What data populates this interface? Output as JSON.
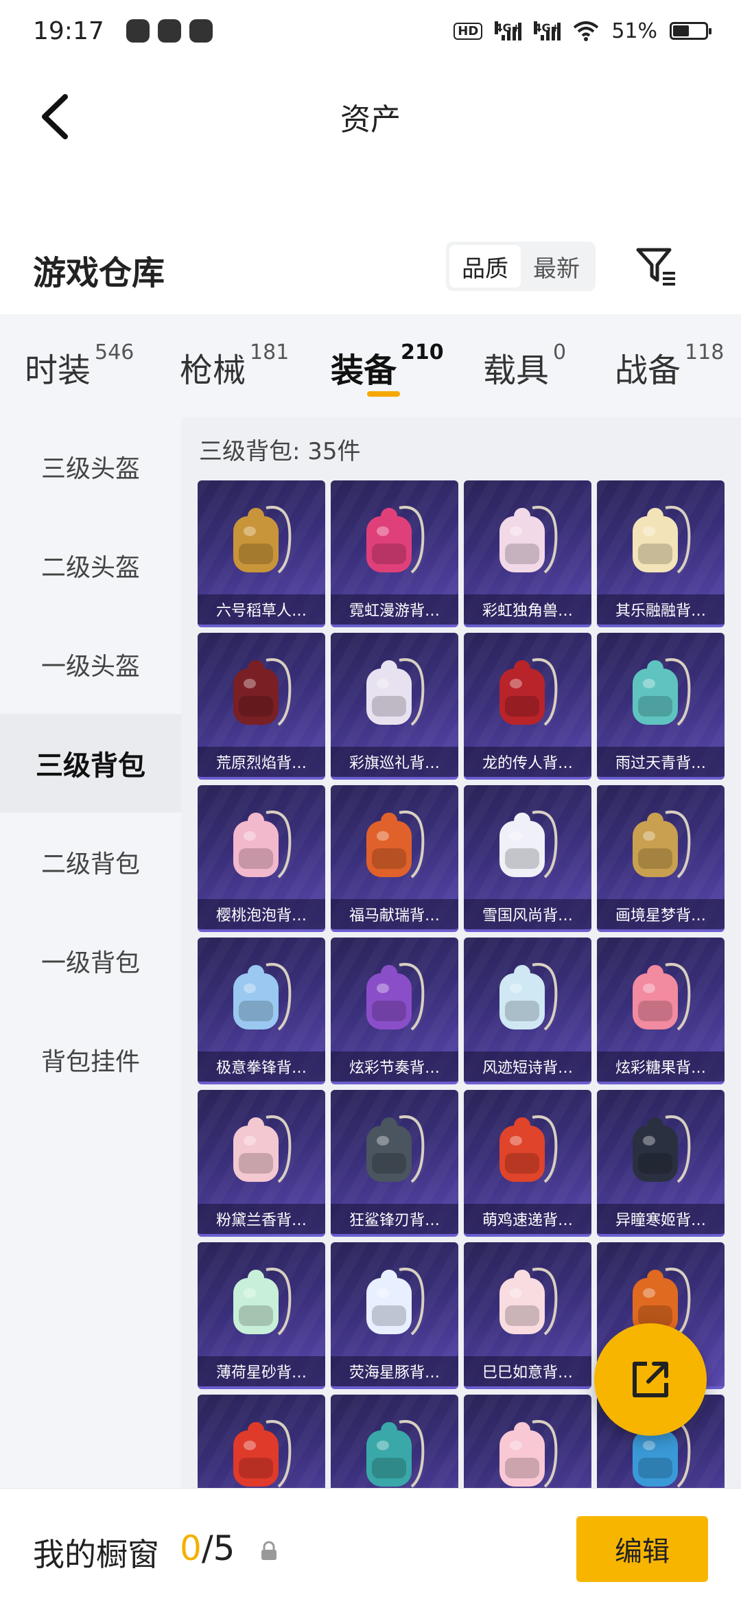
{
  "status_bar": {
    "time": "19:17",
    "battery": "51%",
    "battery_level": 0.51,
    "network_1": "4G+",
    "network_2": "4G+",
    "hd_label": "HD"
  },
  "header": {
    "title": "资产"
  },
  "warehouse": {
    "title": "游戏仓库",
    "sort_options": [
      "品质",
      "最新"
    ],
    "active_sort": "品质"
  },
  "tabs": [
    {
      "label": "时装",
      "count": "546"
    },
    {
      "label": "枪械",
      "count": "181"
    },
    {
      "label": "装备",
      "count": "210"
    },
    {
      "label": "载具",
      "count": "0"
    },
    {
      "label": "战备",
      "count": "118"
    }
  ],
  "active_tab": "装备",
  "sidebar": {
    "items": [
      "三级头盔",
      "二级头盔",
      "一级头盔",
      "三级背包",
      "二级背包",
      "一级背包",
      "背包挂件"
    ],
    "active": "三级背包"
  },
  "section": {
    "title": "三级背包: 35件"
  },
  "items": [
    "六号稻草人…",
    "霓虹漫游背…",
    "彩虹独角兽…",
    "其乐融融背…",
    "荒原烈焰背…",
    "彩旗巡礼背…",
    "龙的传人背…",
    "雨过天青背…",
    "樱桃泡泡背…",
    "福马献瑞背…",
    "雪国风尚背…",
    "画境星梦背…",
    "极意拳锋背…",
    "炫彩节奏背…",
    "风迹短诗背…",
    "炫彩糖果背…",
    "粉黛兰香背…",
    "狂鲨锋刃背…",
    "萌鸡速递背…",
    "异瞳寒姬背…",
    "薄荷星砂背…",
    "荧海星豚背…",
    "巳巳如意背…",
    "",
    "",
    "",
    "",
    ""
  ],
  "item_colors": [
    "#c9953a",
    "#e0407a",
    "#f2d9e8",
    "#f3e3b8",
    "#7a1f24",
    "#e8e2f0",
    "#b8242a",
    "#5fc4c0",
    "#f2b8cc",
    "#e0622a",
    "#f0f0f8",
    "#c8a050",
    "#9ac8f0",
    "#8a4fc8",
    "#cfe8f4",
    "#f28aa0",
    "#f4c8d0",
    "#4a5560",
    "#e0442a",
    "#2a3040",
    "#c8f0d8",
    "#e8f0ff",
    "#f8dce0",
    "#e06a20",
    "#e03a2a",
    "#3aa8a8",
    "#f8c8d4",
    "#3a9ad8"
  ],
  "bottom_bar": {
    "label": "我的橱窗",
    "current": "0",
    "total": "/5",
    "edit": "编辑"
  }
}
